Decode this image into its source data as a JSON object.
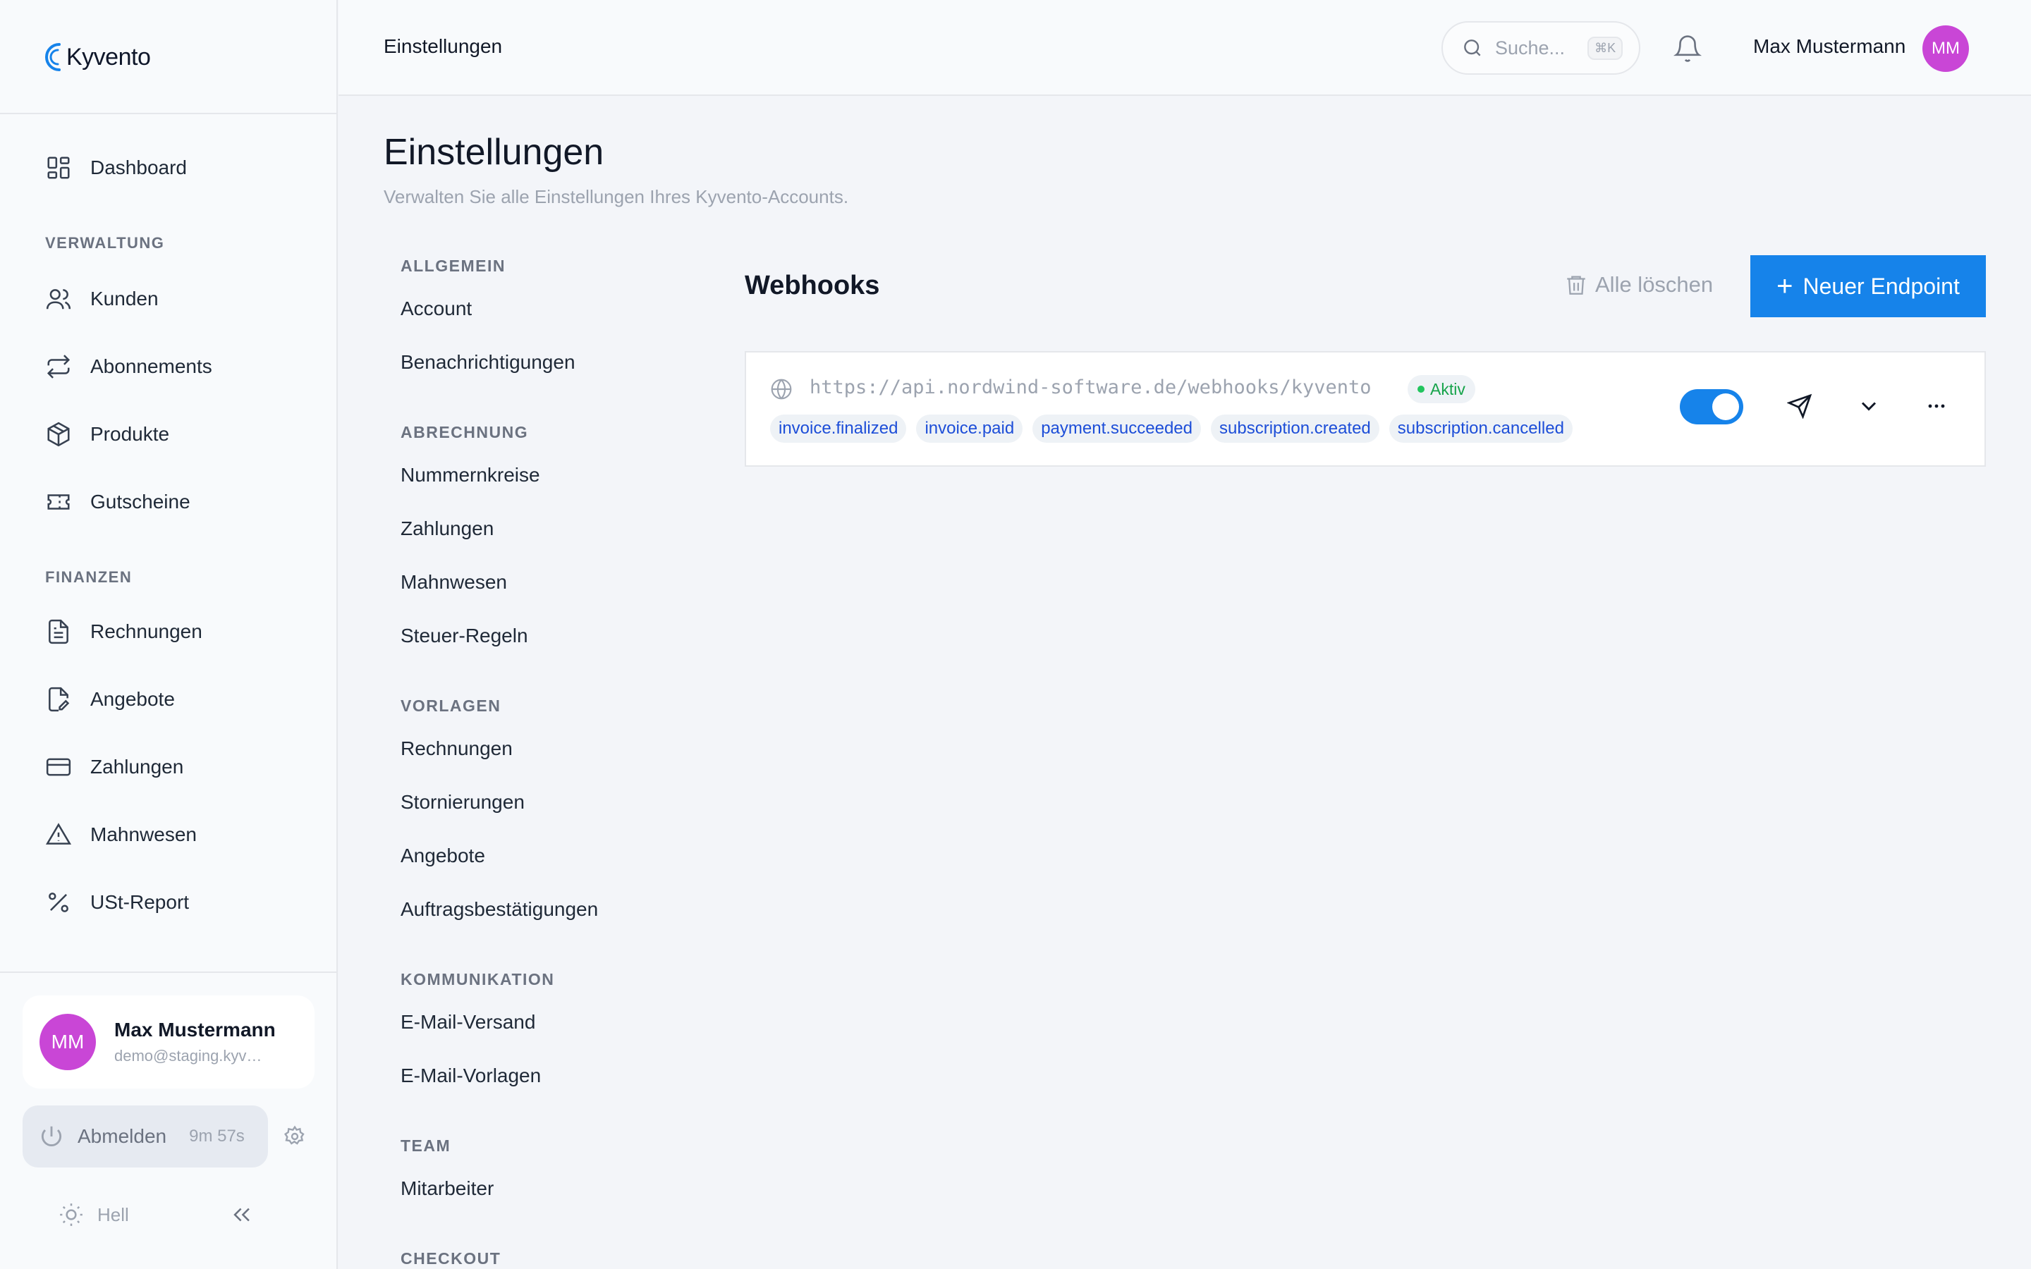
{
  "app": {
    "name": "Kyvento"
  },
  "sidebar": {
    "dashboard": "Dashboard",
    "sections": {
      "verwaltung": "VERWALTUNG",
      "finanzen": "FINANZEN"
    },
    "verwaltung_items": [
      "Kunden",
      "Abonnements",
      "Produkte",
      "Gutscheine"
    ],
    "finanzen_items": [
      "Rechnungen",
      "Angebote",
      "Zahlungen",
      "Mahnwesen",
      "USt-Report"
    ],
    "user": {
      "initials": "MM",
      "name": "Max Mustermann",
      "email": "demo@staging.kyvent..."
    },
    "logout": {
      "label": "Abmelden",
      "timer": "9m 57s"
    },
    "theme": "Hell"
  },
  "topbar": {
    "title": "Einstellungen",
    "search_placeholder": "Suche...",
    "search_shortcut": "⌘K",
    "user_name": "Max Mustermann",
    "user_initials": "MM"
  },
  "page": {
    "title": "Einstellungen",
    "subtitle": "Verwalten Sie alle Einstellungen Ihres Kyvento-Accounts."
  },
  "settings_nav": {
    "allgemein": {
      "title": "ALLGEMEIN",
      "items": [
        "Account",
        "Benachrichtigungen"
      ]
    },
    "abrechnung": {
      "title": "ABRECHNUNG",
      "items": [
        "Nummernkreise",
        "Zahlungen",
        "Mahnwesen",
        "Steuer-Regeln"
      ]
    },
    "vorlagen": {
      "title": "VORLAGEN",
      "items": [
        "Rechnungen",
        "Stornierungen",
        "Angebote",
        "Auftragsbestätigungen"
      ]
    },
    "kommunikation": {
      "title": "KOMMUNIKATION",
      "items": [
        "E-Mail-Versand",
        "E-Mail-Vorlagen"
      ]
    },
    "team": {
      "title": "TEAM",
      "items": [
        "Mitarbeiter"
      ]
    },
    "checkout": {
      "title": "CHECKOUT"
    }
  },
  "webhooks": {
    "title": "Webhooks",
    "clear_all": "Alle löschen",
    "new_endpoint": "Neuer Endpoint",
    "endpoint": {
      "url": "https://api.nordwind-software.de/webhooks/kyvento",
      "status": "Aktiv",
      "enabled": true,
      "events": [
        "invoice.finalized",
        "invoice.paid",
        "payment.succeeded",
        "subscription.created",
        "subscription.cancelled"
      ]
    }
  },
  "colors": {
    "primary": "#1683ea",
    "avatar": "#c946d6",
    "active": "#16a34a"
  }
}
